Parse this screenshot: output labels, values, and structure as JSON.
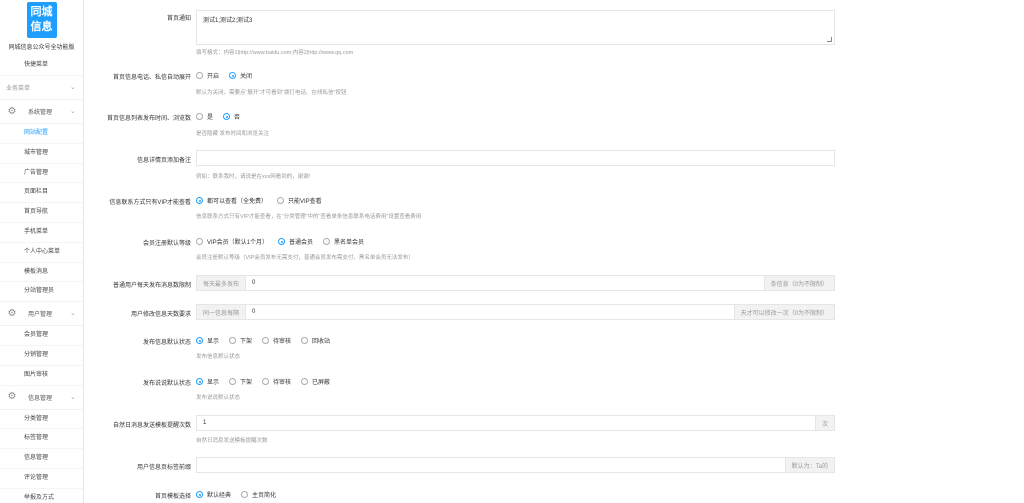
{
  "sidebar": {
    "logo_line1": "同城",
    "logo_line2": "信息",
    "subtitle": "同城信息公众号全功能版",
    "quick_menu": "快捷菜单",
    "biz_menu": "业务菜单",
    "groups": [
      {
        "title": "系统管理",
        "items": [
          "网站配置",
          "城市管理",
          "广告管理",
          "页面栏目",
          "首页导航",
          "手机菜单",
          "个人中心菜单",
          "模板消息",
          "分站管理员"
        ]
      },
      {
        "title": "用户管理",
        "items": [
          "会员管理",
          "分销管理",
          "图片审核"
        ]
      },
      {
        "title": "信息管理",
        "items": [
          "分类管理",
          "标签管理",
          "信息管理",
          "评论管理",
          "举报及方式"
        ]
      }
    ],
    "active_item": "网站配置"
  },
  "form": {
    "notice": {
      "label": "首页通知",
      "value": "测试1;测试2;测试3",
      "help": "填写格式：内容1|http://www.baidu.com;内容2|http://www.qq.com"
    },
    "auto_expand": {
      "label": "首页信息电话、私信自动展开",
      "options": [
        "开启",
        "关闭"
      ],
      "selected": 1,
      "help": "默认为关闭，需要点“展开”才可看到“拨打电话、在线私信”按钮"
    },
    "show_time": {
      "label": "首页信息列表发布时间、浏览数",
      "options": [
        "是",
        "否"
      ],
      "selected": 1,
      "help": "是否隐藏 发布时间和浏览关注"
    },
    "detail_remark": {
      "label": "信息详情页添加备注",
      "value": "",
      "help": "例如：联系我时，请说是在xxx网看到的，谢谢!"
    },
    "vip_contact": {
      "label": "信息联系方式只有VIP才能查看",
      "options": [
        "都可以查看（全免费）",
        "只能VIP查看"
      ],
      "selected": 0,
      "help": "信息联系方式只有VIP才能查看，在“分类管理”中的“查看单条信息联系电话费用”设置查看费用"
    },
    "default_level": {
      "label": "会员注册默认等级",
      "options": [
        "VIP会员（默认1个月）",
        "普通会员",
        "黑名单会员"
      ],
      "selected": 1,
      "help": "会员注册默认等级（VIP会员发布无需支付，普通会员发布需支付，黑名单会员无法发布）"
    },
    "daily_limit": {
      "label": "普通用户每天发布消息数限制",
      "prefix": "每天最多发布",
      "value": "0",
      "suffix": "条信息（0为不限制）"
    },
    "edit_days": {
      "label": "用户修改信息天数要求",
      "prefix": "同一信息每隔",
      "value": "0",
      "suffix": "天才可以修改一次（0为不限制）"
    },
    "publish_status": {
      "label": "发布信息默认状态",
      "options": [
        "显示",
        "下架",
        "待审核",
        "回收站"
      ],
      "selected": 0,
      "help": "发布信息默认状态"
    },
    "comment_status": {
      "label": "发布说说默认状态",
      "options": [
        "显示",
        "下架",
        "待审核",
        "已屏蔽"
      ],
      "selected": 0,
      "help": "发布说说默认状态"
    },
    "remind_count": {
      "label": "自然日消息发送模板提醒次数",
      "value": "1",
      "suffix": "次",
      "help": "自然日消息发送模板提醒次数"
    },
    "tag_prefix": {
      "label": "用户信息页标签前缀",
      "value": "",
      "suffix": "默认为：Ta的"
    },
    "template": {
      "label": "首页模板选择",
      "options": [
        "默认经典",
        "主页简化"
      ],
      "selected": 0
    }
  }
}
